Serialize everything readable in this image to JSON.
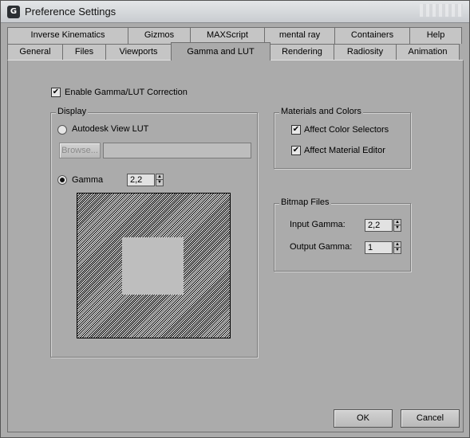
{
  "window": {
    "title": "Preference Settings",
    "icon": "3ds-max-logo-icon",
    "icon_glyph": "G"
  },
  "tabs": {
    "top_row": [
      "Inverse Kinematics",
      "Gizmos",
      "MAXScript",
      "mental ray",
      "Containers",
      "Help"
    ],
    "bottom_row": [
      "General",
      "Files",
      "Viewports",
      "Gamma and LUT",
      "Rendering",
      "Radiosity",
      "Animation"
    ],
    "active": "Gamma and LUT"
  },
  "enable_correction": {
    "label": "Enable Gamma/LUT Correction",
    "checked": true
  },
  "display": {
    "title": "Display",
    "lut_radio_label": "Autodesk View LUT",
    "lut_selected": false,
    "browse_label": "Browse...",
    "lut_path": "",
    "gamma_radio_label": "Gamma",
    "gamma_selected": true,
    "gamma_value": "2,2"
  },
  "materials": {
    "title": "Materials and Colors",
    "affect_color_selectors": {
      "label": "Affect Color Selectors",
      "checked": true
    },
    "affect_material_editor": {
      "label": "Affect Material Editor",
      "checked": true
    }
  },
  "bitmap": {
    "title": "Bitmap Files",
    "input_label": "Input Gamma:",
    "input_value": "2,2",
    "output_label": "Output Gamma:",
    "output_value": "1"
  },
  "buttons": {
    "ok": "OK",
    "cancel": "Cancel"
  },
  "glyphs": {
    "check": "✔",
    "spin_up": "▲",
    "spin_down": "▼"
  }
}
